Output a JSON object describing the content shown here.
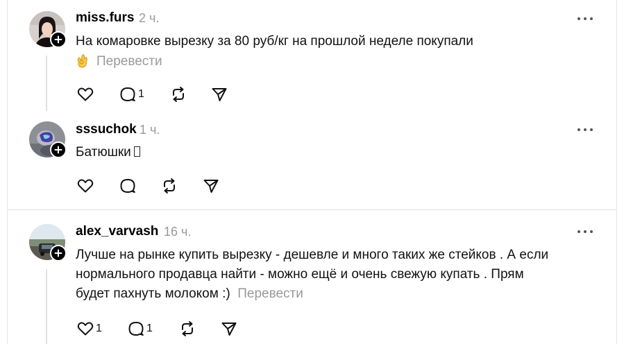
{
  "posts": [
    {
      "username": "miss.furs",
      "time": "2 ч.",
      "text": "На комаровке вырезку за 80 руб/кг на прошлой неделе покупали",
      "translate": "Перевести",
      "emoji": "ok-hand-emoji",
      "likes": "",
      "replies": "1"
    },
    {
      "username": "sssuchok",
      "time": "1 ч.",
      "text": "Батюшки",
      "likes": "",
      "replies": ""
    },
    {
      "username": "alex_varvash",
      "time": "16 ч.",
      "text_lines": [
        "Лучше на рынке купить вырезку - дешевле и много таких же стейков . А если",
        "нормального продавца найти - можно ещё и очень свежую купать . Прям",
        "будет пахнуть молоком :)"
      ],
      "translate": "Перевести",
      "likes": "1",
      "replies": "1"
    }
  ],
  "icons": {
    "like": "heart-icon",
    "reply": "comment-icon",
    "repost": "repost-icon",
    "share": "send-icon",
    "more": "more-icon",
    "follow": "plus-icon"
  },
  "colors": {
    "muted": "#999999",
    "divider": "#e0e0e0"
  }
}
